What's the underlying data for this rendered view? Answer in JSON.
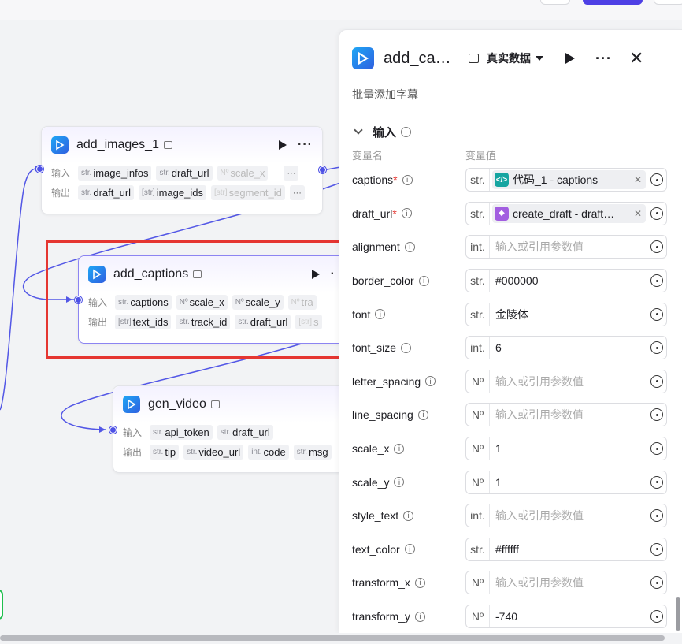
{
  "canvas": {
    "nodes": [
      {
        "title": "add_images_1",
        "inputs_label": "输入",
        "outputs_label": "输出",
        "inputs": [
          {
            "type": "str.",
            "name": "image_infos"
          },
          {
            "type": "str.",
            "name": "draft_url"
          },
          {
            "type": "Nº",
            "name": "scale_x"
          }
        ],
        "outputs": [
          {
            "type": "str.",
            "name": "draft_url"
          },
          {
            "type": "[str]",
            "name": "image_ids"
          },
          {
            "type": "[str]",
            "name": "segment_id"
          }
        ],
        "more": "···"
      },
      {
        "title": "add_captions",
        "inputs_label": "输入",
        "outputs_label": "输出",
        "inputs": [
          {
            "type": "str.",
            "name": "captions"
          },
          {
            "type": "Nº",
            "name": "scale_x"
          },
          {
            "type": "Nº",
            "name": "scale_y"
          },
          {
            "type": "Nº",
            "name": "tra"
          }
        ],
        "outputs": [
          {
            "type": "[str]",
            "name": "text_ids"
          },
          {
            "type": "str.",
            "name": "track_id"
          },
          {
            "type": "str.",
            "name": "draft_url"
          },
          {
            "type": "[str]",
            "name": "s"
          }
        ],
        "more": "·"
      },
      {
        "title": "gen_video",
        "inputs_label": "输入",
        "outputs_label": "输出",
        "inputs": [
          {
            "type": "str.",
            "name": "api_token"
          },
          {
            "type": "str.",
            "name": "draft_url"
          }
        ],
        "outputs": [
          {
            "type": "str.",
            "name": "tip"
          },
          {
            "type": "str.",
            "name": "video_url"
          },
          {
            "type": "int.",
            "name": "code"
          },
          {
            "type": "str.",
            "name": "msg"
          }
        ]
      }
    ]
  },
  "panel": {
    "title": "add_ca…",
    "data_mode": "真实数据",
    "more": "···",
    "close": "✕",
    "description": "批量添加字幕",
    "section_title": "输入",
    "col_name": "变量名",
    "col_value": "变量值",
    "params": [
      {
        "name": "captions",
        "required": true,
        "type": "str.",
        "ref": {
          "kind": "code",
          "text": "代码_1 - captions"
        }
      },
      {
        "name": "draft_url",
        "required": true,
        "type": "str.",
        "ref": {
          "kind": "pkg",
          "text": "create_draft - draft…"
        }
      },
      {
        "name": "alignment",
        "required": false,
        "type": "int.",
        "placeholder": "输入或引用参数值"
      },
      {
        "name": "border_color",
        "required": false,
        "type": "str.",
        "value": "#000000"
      },
      {
        "name": "font",
        "required": false,
        "type": "str.",
        "value": "金陵体"
      },
      {
        "name": "font_size",
        "required": false,
        "type": "int.",
        "value": "6"
      },
      {
        "name": "letter_spacing",
        "required": false,
        "type": "Nº",
        "placeholder": "输入或引用参数值"
      },
      {
        "name": "line_spacing",
        "required": false,
        "type": "Nº",
        "placeholder": "输入或引用参数值"
      },
      {
        "name": "scale_x",
        "required": false,
        "type": "Nº",
        "value": "1"
      },
      {
        "name": "scale_y",
        "required": false,
        "type": "Nº",
        "value": "1"
      },
      {
        "name": "style_text",
        "required": false,
        "type": "int.",
        "placeholder": "输入或引用参数值"
      },
      {
        "name": "text_color",
        "required": false,
        "type": "str.",
        "value": "#ffffff"
      },
      {
        "name": "transform_x",
        "required": false,
        "type": "Nº",
        "placeholder": "输入或引用参数值"
      },
      {
        "name": "transform_y",
        "required": false,
        "type": "Nº",
        "value": "-740"
      }
    ]
  },
  "colors": {
    "accent": "#4e52e5",
    "selection": "#e53631",
    "node_icon": "#1ea7f5"
  }
}
